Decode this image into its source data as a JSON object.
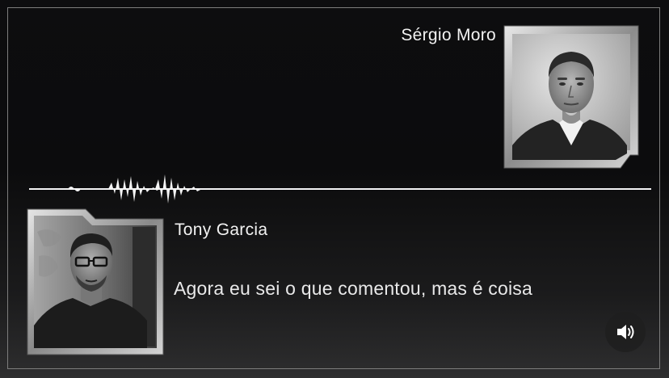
{
  "speakers": {
    "top": {
      "name": "Sérgio Moro"
    },
    "bottom": {
      "name": "Tony Garcia"
    }
  },
  "transcript": {
    "text": "Agora eu sei o que comentou, mas é coisa"
  },
  "controls": {
    "sound_icon": "speaker-volume-icon"
  },
  "colors": {
    "background": "#0c0c0d",
    "text": "#f2f2f2",
    "frame": "#7d7d7d"
  }
}
